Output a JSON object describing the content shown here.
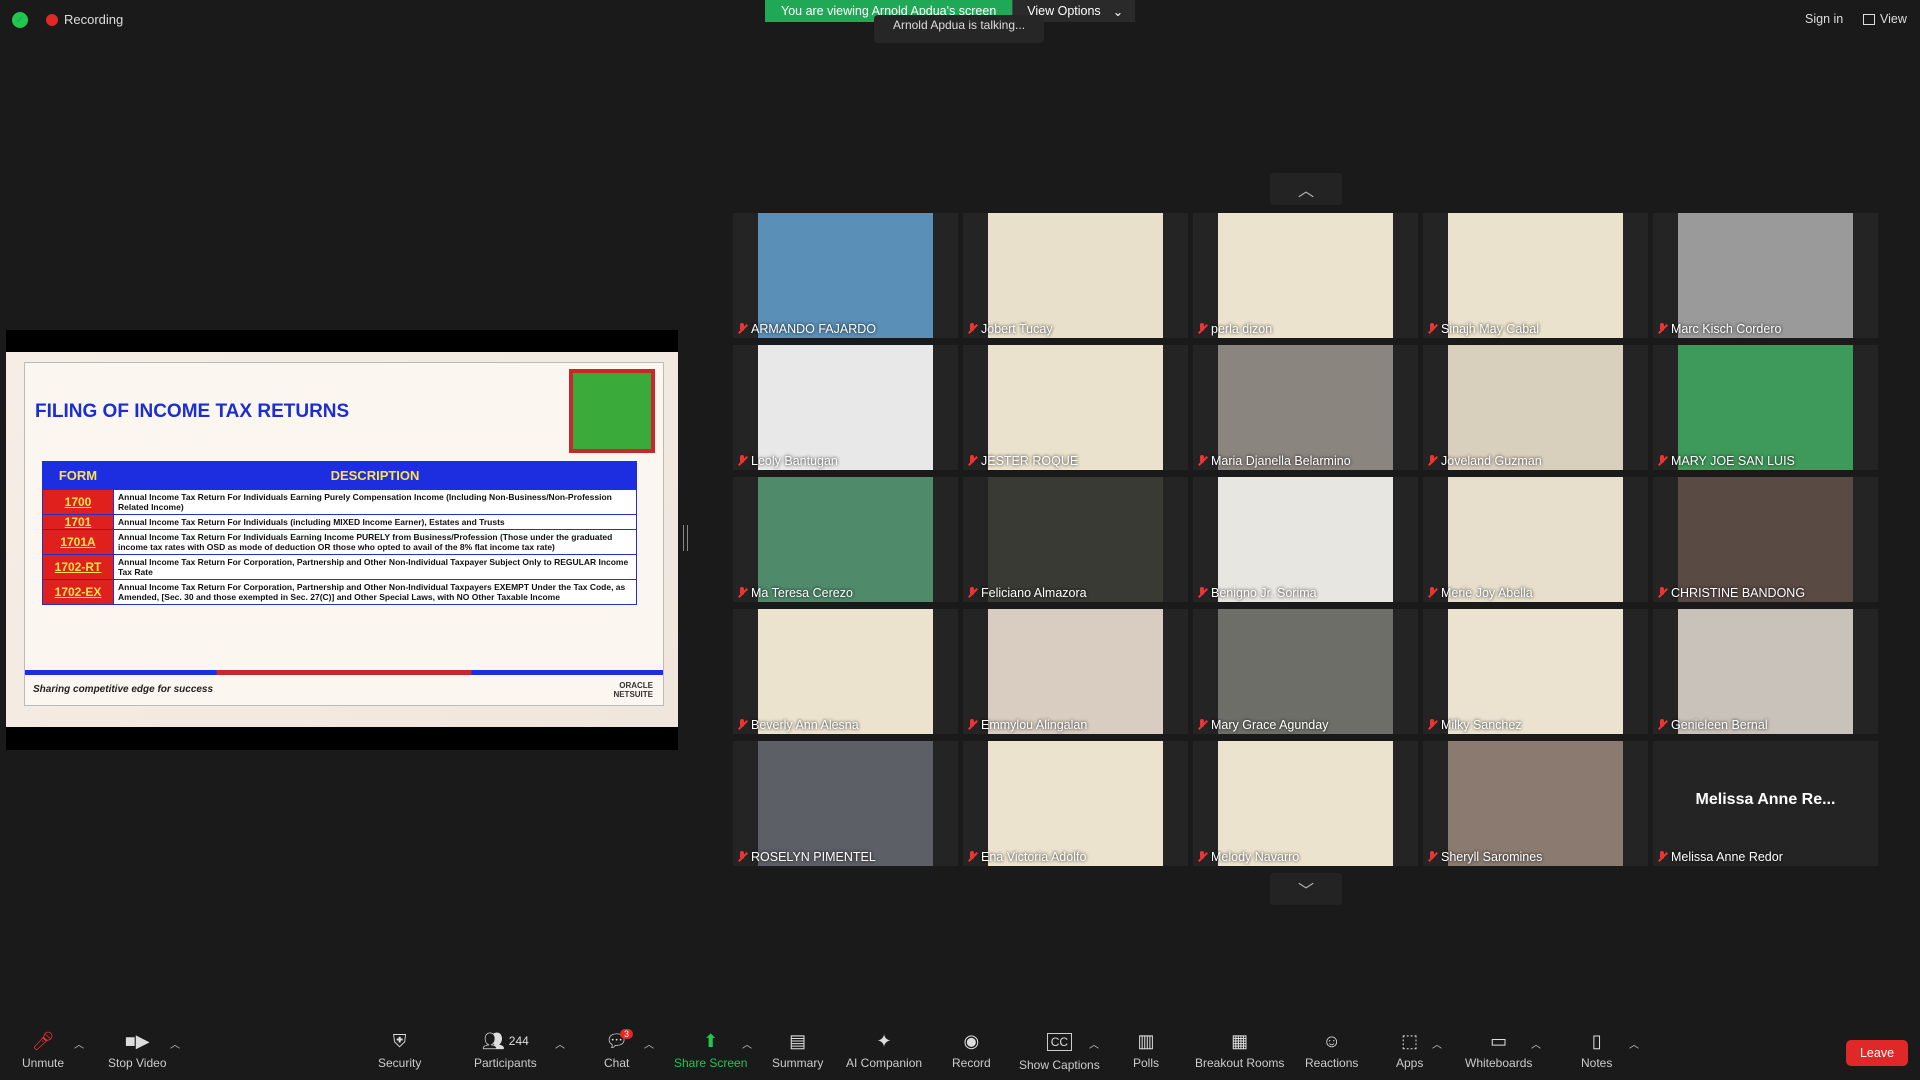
{
  "top": {
    "recording": "Recording",
    "banner": "You are viewing Arnold Apdua's screen",
    "view_options": "View Options",
    "talking": "Arnold Apdua is talking...",
    "sign_in": "Sign in",
    "view": "View"
  },
  "slide": {
    "title": "FILING OF INCOME TAX RETURNS",
    "col_form": "FORM",
    "col_desc": "DESCRIPTION",
    "rows": [
      {
        "form": "1700",
        "desc": "Annual Income Tax Return For Individuals Earning Purely Compensation Income (Including Non-Business/Non-Profession Related Income)"
      },
      {
        "form": "1701",
        "desc": "Annual Income Tax Return For Individuals (including MIXED Income Earner), Estates and Trusts"
      },
      {
        "form": "1701A",
        "desc": "Annual Income Tax Return For Individuals Earning Income PURELY from Business/Profession (Those under the graduated income tax rates with OSD as mode of deduction OR those who opted to avail of the 8% flat income tax rate)"
      },
      {
        "form": "1702-RT",
        "desc": "Annual Income Tax Return For Corporation, Partnership and Other Non-Individual Taxpayer Subject Only to REGULAR Income Tax Rate"
      },
      {
        "form": "1702-EX",
        "desc": "Annual Income Tax Return For Corporation, Partnership and Other Non-Individual Taxpayers EXEMPT Under the Tax Code, as Amended, [Sec. 30 and those exempted in Sec. 27(C)] and Other Special Laws, with NO Other Taxable Income"
      }
    ],
    "footer": "Sharing competitive edge for success",
    "logo_line1": "ORACLE",
    "logo_line2": "NETSUITE"
  },
  "participants": [
    {
      "name": "ARMANDO FAJARDO",
      "bg": "#5a8fb8"
    },
    {
      "name": "Jobert Tucay",
      "bg": "#e9e0cc"
    },
    {
      "name": "perla dizon",
      "bg": "#ece3cf"
    },
    {
      "name": "Sinajh May Cabal",
      "bg": "#ebe2cd"
    },
    {
      "name": "Marc Kisch Cordero",
      "bg": "#9a9a9a"
    },
    {
      "name": "Leoly Bantugan",
      "bg": "#e8e8e8"
    },
    {
      "name": "JESTER ROQUE",
      "bg": "#ebe2cd"
    },
    {
      "name": "Maria Djanella Belarmino",
      "bg": "#8b857f"
    },
    {
      "name": "Joveland Guzman",
      "bg": "#d9cfbd"
    },
    {
      "name": "MARY JOE SAN LUIS",
      "bg": "#3e9a5a"
    },
    {
      "name": "Ma Teresa Cerezo",
      "bg": "#4f8a6a"
    },
    {
      "name": "Feliciano Almazora",
      "bg": "#3a3a34"
    },
    {
      "name": "Benigno Jr. Sorima",
      "bg": "#e8e6e0"
    },
    {
      "name": "Merie Joy Abella",
      "bg": "#e7dfcc"
    },
    {
      "name": "CHRISTINE BANDONG",
      "bg": "#5a4a44"
    },
    {
      "name": "Beverly Ann Alesna",
      "bg": "#ece3cf"
    },
    {
      "name": "Emmylou Alingalan",
      "bg": "#d8cdc0"
    },
    {
      "name": "Mary Grace Agunday",
      "bg": "#6e6e68"
    },
    {
      "name": "Milky Sanchez",
      "bg": "#ebe3d0"
    },
    {
      "name": "Genieleen Bernal",
      "bg": "#c9c2ba"
    },
    {
      "name": "ROSELYN PIMENTEL",
      "bg": "#5c5f66"
    },
    {
      "name": "Ena Victoria Adolfo",
      "bg": "#ece3cf"
    },
    {
      "name": "Melody Navarro",
      "bg": "#ece3cf"
    },
    {
      "name": "Sheryll Saromines",
      "bg": "#8a7a70"
    },
    {
      "name": "Melissa Anne Redor",
      "bg": "#242424",
      "big": "Melissa Anne Re..."
    }
  ],
  "toolbar": {
    "unmute": "Unmute",
    "stop_video": "Stop Video",
    "security": "Security",
    "participants": "Participants",
    "participants_count": "244",
    "chat": "Chat",
    "chat_badge": "3",
    "share_screen": "Share Screen",
    "summary": "Summary",
    "ai_companion": "AI Companion",
    "record": "Record",
    "show_captions": "Show Captions",
    "polls": "Polls",
    "breakout_rooms": "Breakout Rooms",
    "reactions": "Reactions",
    "apps": "Apps",
    "whiteboards": "Whiteboards",
    "notes": "Notes",
    "leave": "Leave"
  }
}
